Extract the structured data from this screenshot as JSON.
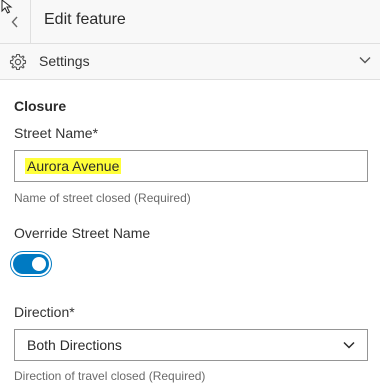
{
  "header": {
    "title": "Edit feature",
    "back_icon": "chevron-left-icon"
  },
  "settings": {
    "label": "Settings",
    "icon": "gear-icon",
    "expand_icon": "chevron-down-icon"
  },
  "form": {
    "group_title": "Closure",
    "street_name": {
      "label": "Street Name*",
      "value": "Aurora Avenue",
      "hint": "Name of street closed (Required)"
    },
    "override": {
      "label": "Override Street Name",
      "checked": true
    },
    "direction": {
      "label": "Direction*",
      "selected": "Both Directions",
      "hint": "Direction of travel closed (Required)"
    }
  },
  "colors": {
    "accent": "#007ac2",
    "highlight": "#ffff3a"
  }
}
